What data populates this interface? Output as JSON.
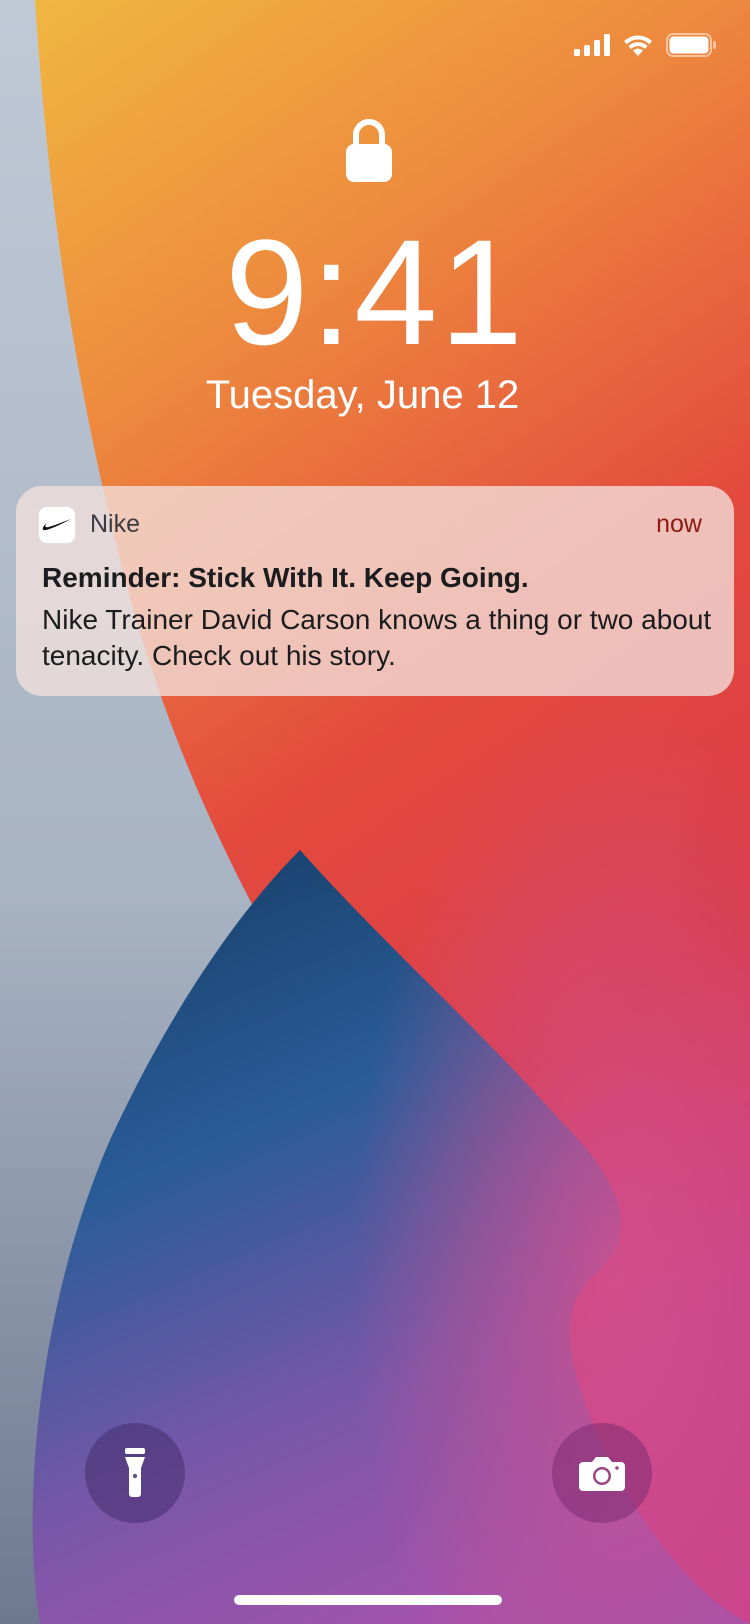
{
  "status_bar": {
    "signal_icon": "cellular-signal-icon",
    "wifi_icon": "wifi-icon",
    "battery_icon": "battery-icon",
    "battery_level": 1.0
  },
  "lock_screen": {
    "lock_icon": "lock-icon",
    "time": "9:41",
    "date": "Tuesday, June 12"
  },
  "notification": {
    "app_icon": "nike-swoosh-icon",
    "app_name": "Nike",
    "time": "now",
    "title": "Reminder: Stick With It. Keep Going.",
    "body": "Nike Trainer David Carson knows a thing or two about tenacity. Check out his story."
  },
  "controls": {
    "flashlight_icon": "flashlight-icon",
    "camera_icon": "camera-icon"
  },
  "colors": {
    "notification_time": "#8b1a10",
    "wallpaper_orange": "#f08a3a",
    "wallpaper_red": "#e2443e",
    "wallpaper_blue": "#2a5890",
    "wallpaper_purple": "#8d58b0",
    "wallpaper_gray": "#b6c0ce"
  }
}
